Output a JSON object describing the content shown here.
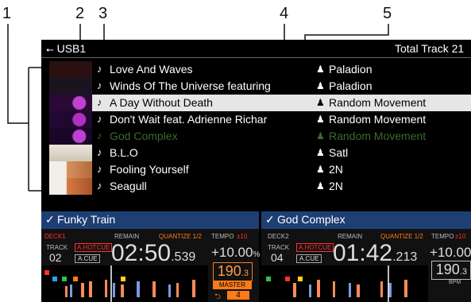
{
  "callouts": [
    "1",
    "2",
    "3",
    "4",
    "5"
  ],
  "screen": {
    "device": "USB1",
    "device_icon": "usb-icon",
    "total_label": "Total Track 21"
  },
  "tracks": [
    {
      "title": "Love And Waves",
      "artist": "Paladion",
      "thumb_color": "#3a1a1a"
    },
    {
      "title": "Winds Of The Universe featuring",
      "artist": "Paladion",
      "thumb_color": "#221a2a"
    },
    {
      "title": "A Day Without Death",
      "artist": "Random Movement",
      "thumb_color": "#6a2a8a",
      "selected": true
    },
    {
      "title": "Don't Wait feat. Adrienne Richar",
      "artist": "Random Movement",
      "thumb_color": "#5a2a7a"
    },
    {
      "title": "God Complex",
      "artist": "Random Movement",
      "thumb_color": "#7a2a8a",
      "dim": true
    },
    {
      "title": "B.L.O",
      "artist": "Satl",
      "thumb_color": "#d9d2c4"
    },
    {
      "title": "Fooling Yourself",
      "artist": "2N",
      "thumb_color": "#c98a5a"
    },
    {
      "title": "Seagull",
      "artist": "2N",
      "thumb_color": "#c66a3a"
    }
  ],
  "deck1": {
    "name": "Funky Train",
    "deck_label": "DECK1",
    "track_label": "TRACK",
    "track_no": "02",
    "remain_label": "REMAIN",
    "quantize": "QUANTIZE 1/2",
    "tempo_label": "TEMPO",
    "tempo_range": "±10",
    "hotcue": "A.HOTCUE",
    "cue": "A.CUE",
    "time_min": "02",
    "time_sec": "50",
    "time_ms": ".539",
    "tempo_value": "+10.00",
    "tempo_unit": "%",
    "bpm_int": "190",
    "bpm_dec": ".3",
    "master": "MASTER",
    "loop_beats": "4"
  },
  "deck2": {
    "name": "God Complex",
    "deck_label": "DECK2",
    "track_label": "TRACK",
    "track_no": "04",
    "remain_label": "REMAIN",
    "quantize": "QUANTIZE 1/2",
    "tempo_label": "TEMPO",
    "tempo_range": "±10",
    "hotcue": "A.HOTCUE",
    "cue": "A.CUE",
    "time_min": "01",
    "time_sec": "42",
    "time_ms": ".213",
    "tempo_value": "+10.00",
    "bpm_int": "190",
    "bpm_dec": ".3",
    "bpm_unit": "BPM"
  }
}
